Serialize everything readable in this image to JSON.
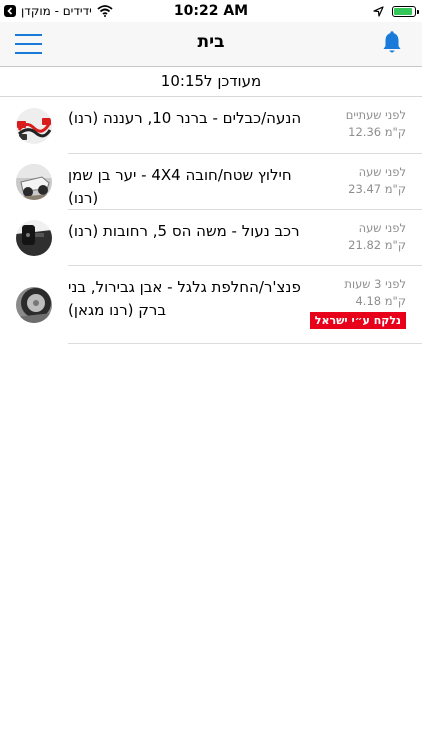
{
  "status_bar": {
    "carrier": "ידידים - מוקדן",
    "time": "10:22 AM",
    "battery_level": 0.9
  },
  "nav": {
    "title": "בית",
    "menu_icon": "hamburger-icon",
    "bell_icon": "bell-icon"
  },
  "update_bar": {
    "text": "מעודכן ל10:15"
  },
  "items": [
    {
      "title": "הנעה/כבלים - ברנר 10, רעננה (רנו)",
      "time_ago": "לפני שעתיים",
      "distance": "12.36 ק\"מ",
      "icon": "jumper-cables"
    },
    {
      "title": "חילוץ שטח/חובה 4X4 - יער בן שמן (רנו)",
      "time_ago": "לפני שעה",
      "distance": "23.47 ק\"מ",
      "icon": "off-road-rescue"
    },
    {
      "title": "רכב נעול - משה הס 5, רחובות (רנו)",
      "time_ago": "לפני שעה",
      "distance": "21.82 ק\"מ",
      "icon": "locked-car"
    },
    {
      "title": "פנצ'ר/החלפת גלגל - אבן גבירול, בני ברק (רנו מגאן)",
      "time_ago": "לפני 3 שעות",
      "distance": "4.18 ק\"מ",
      "badge": "נלקח ע״י ישראל",
      "icon": "flat-tire"
    }
  ],
  "colors": {
    "accent": "#1a7ad9",
    "badge": "#e8001b",
    "meta_text": "#8e8e8e"
  }
}
